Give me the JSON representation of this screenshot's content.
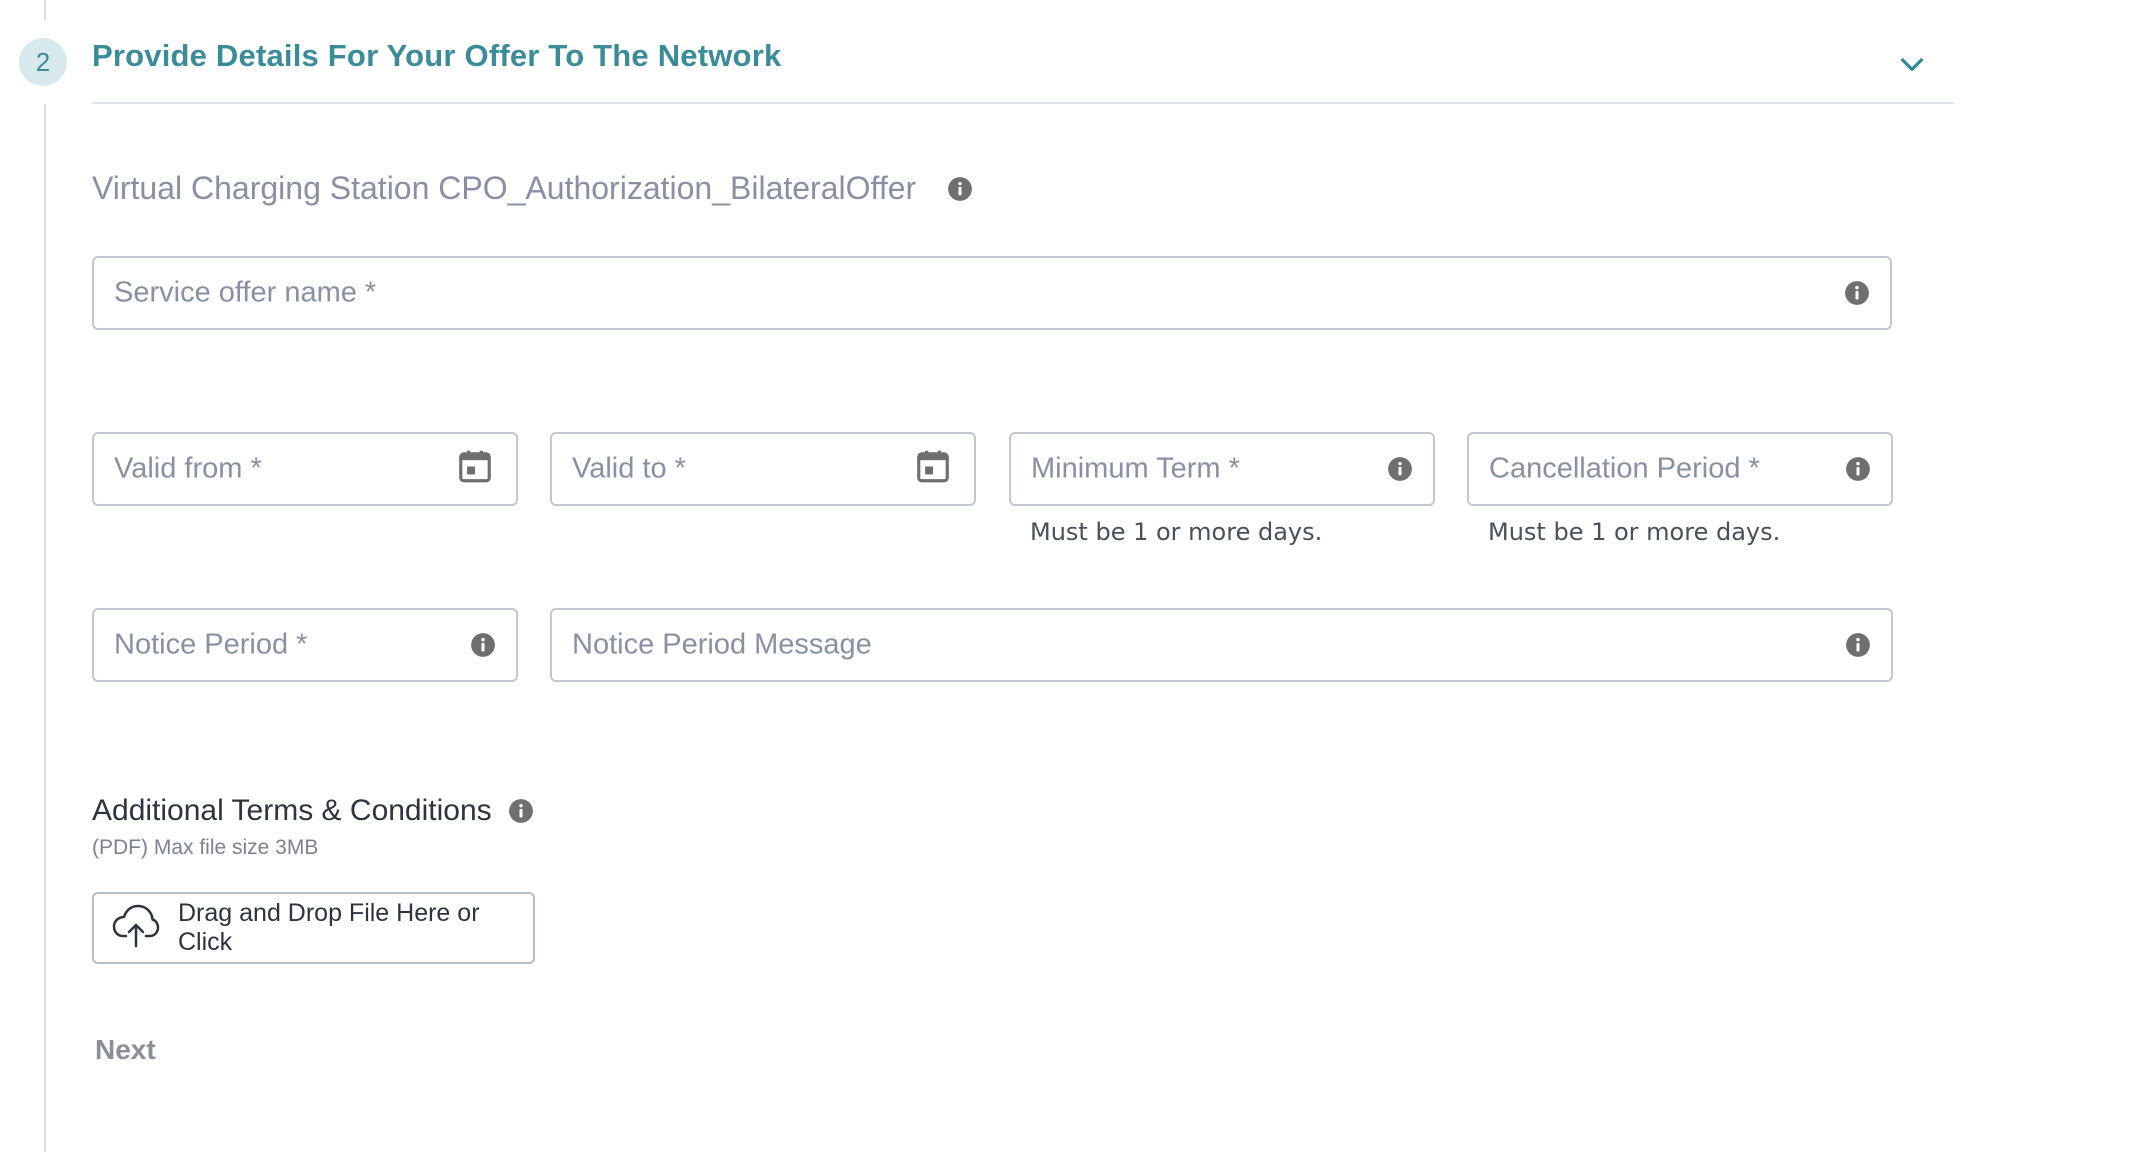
{
  "step": {
    "number": "2",
    "title": "Provide Details For Your Offer To The Network"
  },
  "section": {
    "title": "Virtual Charging Station CPO_Authorization_BilateralOffer"
  },
  "fields": {
    "service_offer_name": "Service offer name *",
    "valid_from": "Valid from *",
    "valid_to": "Valid to *",
    "minimum_term": "Minimum Term *",
    "minimum_term_helper": "Must be 1 or more days.",
    "cancellation_period": "Cancellation Period *",
    "cancellation_period_helper": "Must be 1 or more days.",
    "notice_period": "Notice Period *",
    "notice_period_message": "Notice Period Message"
  },
  "terms": {
    "title": "Additional Terms & Conditions",
    "subtitle": "(PDF) Max file size 3MB",
    "upload_label": "Drag and Drop File Here or Click"
  },
  "actions": {
    "next": "Next"
  },
  "icons": {
    "info": "info-icon",
    "calendar": "calendar-icon",
    "chevron": "chevron-down-icon",
    "upload": "cloud-upload-icon"
  },
  "colors": {
    "accent": "#3b8c99",
    "placeholder": "#8a8fa3",
    "border": "#c3c7d2"
  }
}
